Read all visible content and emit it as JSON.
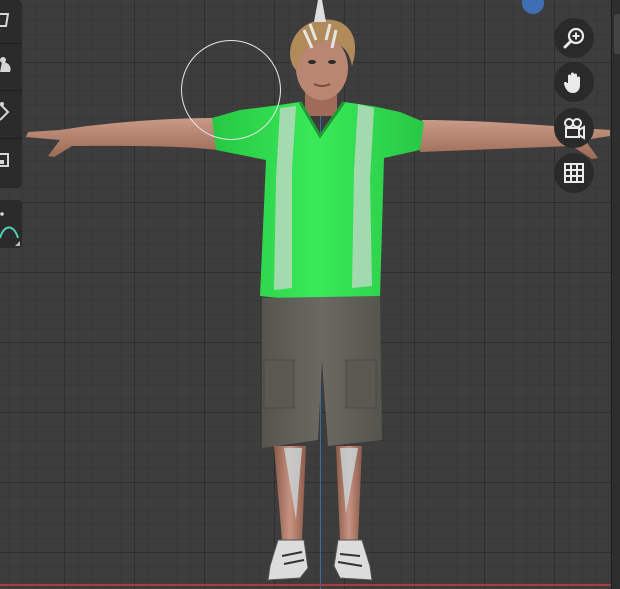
{
  "viewport": {
    "colors": {
      "background": "#3d3d3d",
      "axis_y": "#3f6fa8",
      "axis_x": "#a43d3d",
      "shirt": "#2fe04e",
      "shorts": "#62615a",
      "skin": "#b77f6a",
      "hair": "#b08a58"
    }
  },
  "toolbar": {
    "tools": [
      {
        "name": "draw-tool",
        "icon": "draw-icon"
      },
      {
        "name": "sculpt-tool",
        "icon": "mesh-blob-icon"
      },
      {
        "name": "vertex-tool",
        "icon": "vertex-diamond-icon"
      },
      {
        "name": "box-tool",
        "icon": "box-icon"
      }
    ],
    "curve_tool": {
      "name": "curve-tool",
      "icon": "curve-icon"
    }
  },
  "navigation": {
    "buttons": [
      {
        "name": "zoom-button",
        "icon": "magnifier-plus-icon"
      },
      {
        "name": "pan-button",
        "icon": "hand-icon"
      },
      {
        "name": "camera-button",
        "icon": "camera-icon"
      },
      {
        "name": "grid-toggle-button",
        "icon": "grid-icon"
      }
    ]
  }
}
